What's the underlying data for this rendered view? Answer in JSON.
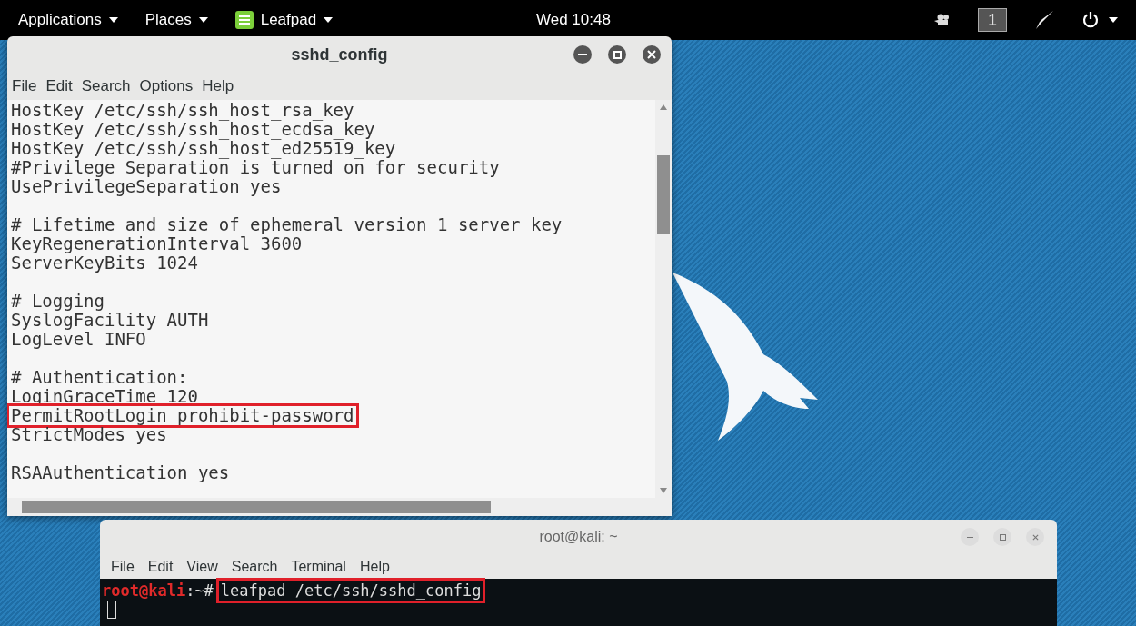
{
  "top_bar": {
    "menus": [
      {
        "label": "Applications",
        "kind": "plain"
      },
      {
        "label": "Places",
        "kind": "plain"
      },
      {
        "label": "Leafpad",
        "kind": "app"
      }
    ],
    "clock": "Wed 10:48",
    "workspace": "1"
  },
  "editor": {
    "title": "sshd_config",
    "menu": [
      "File",
      "Edit",
      "Search",
      "Options",
      "Help"
    ],
    "lines": [
      {
        "text": "HostKey /etc/ssh/ssh_host_rsa_key",
        "highlighted": false
      },
      {
        "text": "HostKey /etc/ssh/ssh_host_ecdsa_key",
        "highlighted": false
      },
      {
        "text": "HostKey /etc/ssh/ssh_host_ed25519_key",
        "highlighted": false
      },
      {
        "text": "#Privilege Separation is turned on for security",
        "highlighted": false
      },
      {
        "text": "UsePrivilegeSeparation yes",
        "highlighted": false
      },
      {
        "text": "# Lifetime and size of ephemeral version 1 server key",
        "highlighted": false,
        "gap_before": true
      },
      {
        "text": "KeyRegenerationInterval 3600",
        "highlighted": false
      },
      {
        "text": "ServerKeyBits 1024",
        "highlighted": false
      },
      {
        "text": "# Logging",
        "highlighted": false,
        "gap_before": true
      },
      {
        "text": "SyslogFacility AUTH",
        "highlighted": false
      },
      {
        "text": "LogLevel INFO",
        "highlighted": false
      },
      {
        "text": "# Authentication:",
        "highlighted": false,
        "gap_before": true
      },
      {
        "text": "LoginGraceTime 120",
        "highlighted": false
      },
      {
        "text": "PermitRootLogin prohibit-password",
        "highlighted": true
      },
      {
        "text": "StrictModes yes",
        "highlighted": false
      },
      {
        "text": "RSAAuthentication yes",
        "highlighted": false,
        "gap_before": true
      }
    ]
  },
  "terminal": {
    "title": "root@kali: ~",
    "menu": [
      "File",
      "Edit",
      "View",
      "Search",
      "Terminal",
      "Help"
    ],
    "prompt_user": "root@kali",
    "prompt_path": ":~#",
    "command": "leafpad /etc/ssh/sshd_config",
    "command_highlighted": true
  }
}
